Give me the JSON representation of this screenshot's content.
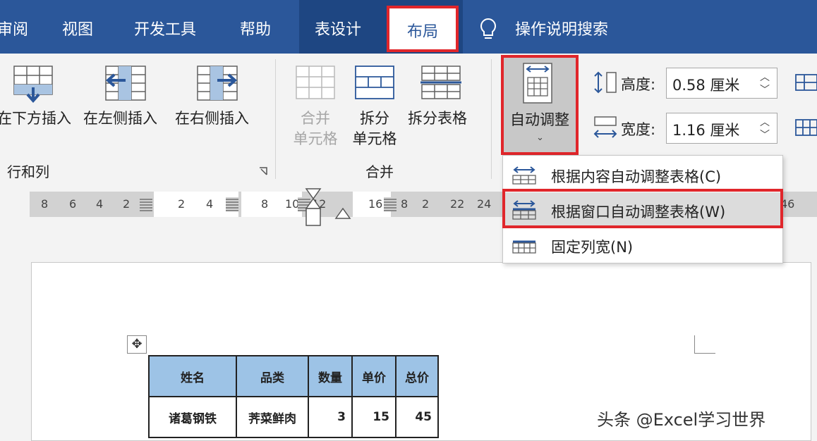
{
  "menu": {
    "tabs": [
      "审阅",
      "视图",
      "开发工具",
      "帮助",
      "表设计",
      "布局"
    ],
    "active_tab": "布局",
    "search_label": "操作说明搜索"
  },
  "ribbon": {
    "insert_below": "在下方插入",
    "insert_left": "在左侧插入",
    "insert_right": "在右侧插入",
    "group_rows_cols": "行和列",
    "merge_cells_1": "合并",
    "merge_cells_2": "单元格",
    "split_cells_1": "拆分",
    "split_cells_2": "单元格",
    "split_table": "拆分表格",
    "group_merge": "合并",
    "autofit": "自动调整",
    "height_label": "高度:",
    "height_value": "0.58 厘米",
    "width_label": "宽度:",
    "width_value": "1.16 厘米"
  },
  "dropdown": {
    "items": [
      {
        "label": "根据内容自动调整表格(C)"
      },
      {
        "label": "根据窗口自动调整表格(W)"
      },
      {
        "label": "固定列宽(N)"
      }
    ],
    "highlighted_index": 1
  },
  "ruler": {
    "numbers": [
      "8",
      "6",
      "4",
      "2",
      "2",
      "4",
      "8",
      "10",
      "12",
      "16",
      "8",
      "2",
      "22",
      "24",
      "46"
    ]
  },
  "table": {
    "headers": [
      "姓名",
      "品类",
      "数量",
      "单价",
      "总价"
    ],
    "rows": [
      [
        "诸葛钢铁",
        "荠菜鲜肉",
        "3",
        "15",
        "45"
      ]
    ]
  },
  "watermark": "头条 @Excel学习世界",
  "colors": {
    "menu_bg": "#2b579a",
    "highlight_red": "#e0262b",
    "header_fill": "#9dc3e6"
  }
}
